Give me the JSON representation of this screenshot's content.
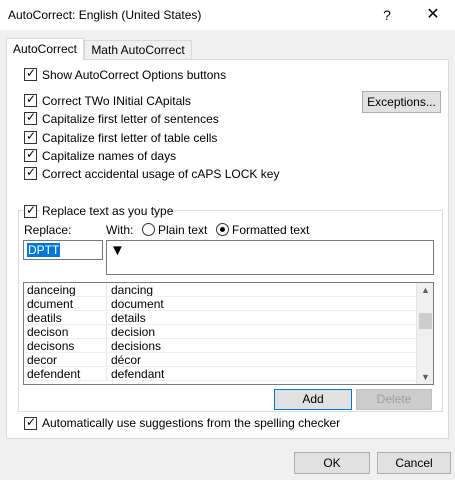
{
  "window": {
    "title": "AutoCorrect: English (United States)",
    "help_glyph": "?",
    "close_glyph": "✕"
  },
  "tabs": [
    {
      "label": "AutoCorrect",
      "active": true
    },
    {
      "label": "Math AutoCorrect",
      "active": false
    }
  ],
  "options": {
    "show_buttons": "Show AutoCorrect Options buttons",
    "correct_two_initial": "Correct TWo INitial CApitals",
    "capitalize_sentences": "Capitalize first letter of sentences",
    "capitalize_table_cells": "Capitalize first letter of table cells",
    "capitalize_days": "Capitalize names of days",
    "caps_lock": "Correct accidental usage of cAPS LOCK key"
  },
  "exceptions_label": "Exceptions...",
  "replace_section": {
    "checkbox_label": "Replace text as you type",
    "replace_label": "Replace:",
    "with_label": "With:",
    "radio_plain": "Plain text",
    "radio_formatted": "Formatted text",
    "replace_value": "DPTT",
    "with_value": "▼"
  },
  "entries": [
    {
      "from": "danceing",
      "to": "dancing"
    },
    {
      "from": "dcument",
      "to": "document"
    },
    {
      "from": "deatils",
      "to": "details"
    },
    {
      "from": "decison",
      "to": "decision"
    },
    {
      "from": "decisons",
      "to": "decisions"
    },
    {
      "from": "decor",
      "to": "décor"
    },
    {
      "from": "defendent",
      "to": "defendant"
    }
  ],
  "add_label": "Add",
  "delete_label": "Delete",
  "suggestions_label": "Automatically use suggestions from the spelling checker",
  "ok_label": "OK",
  "cancel_label": "Cancel",
  "check_glyph": "✓",
  "scroll_up_glyph": "▲",
  "scroll_down_glyph": "▼"
}
